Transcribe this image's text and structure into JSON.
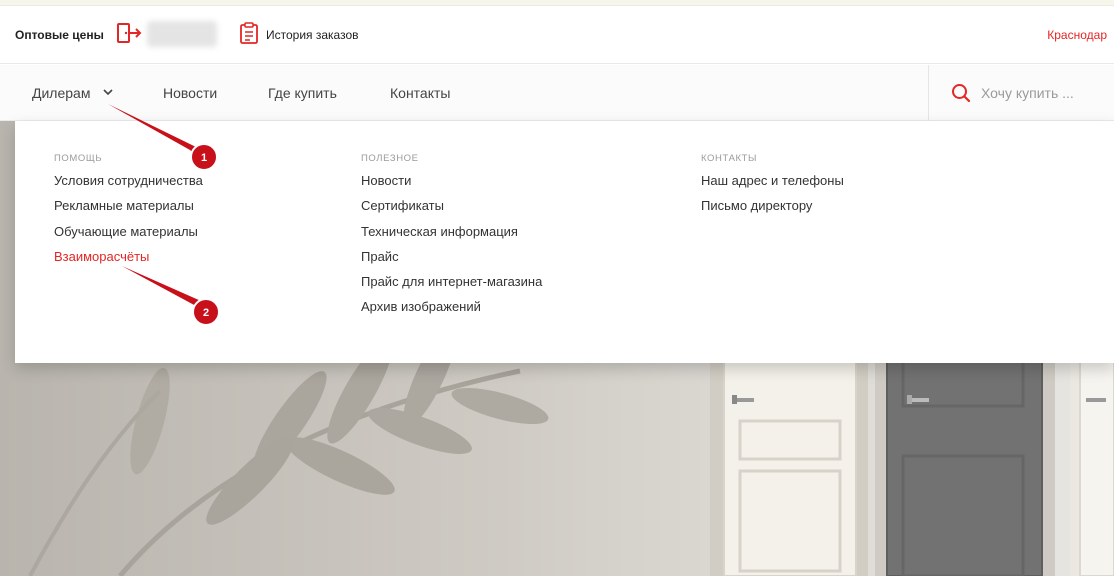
{
  "header": {
    "wholesale_label": "Оптовые цены",
    "history_label": "История заказов",
    "city": "Краснодар"
  },
  "nav": {
    "items": [
      "Дилерам",
      "Новости",
      "Где купить",
      "Контакты"
    ],
    "search_placeholder": "Хочу купить ..."
  },
  "dropdown": {
    "columns": [
      {
        "title": "ПОМОЩЬ",
        "links": [
          "Условия сотрудничества",
          "Рекламные материалы",
          "Обучающие материалы",
          "Взаиморасчёты"
        ]
      },
      {
        "title": "ПОЛЕЗНОЕ",
        "links": [
          "Новости",
          "Сертификаты",
          "Техническая информация",
          "Прайс",
          "Прайс для интернет-магазина",
          "Архив изображений"
        ]
      },
      {
        "title": "КОНТАКТЫ",
        "links": [
          "Наш адрес и телефоны",
          "Письмо директору"
        ]
      }
    ],
    "active_link": "Взаиморасчёты"
  },
  "annotations": {
    "marker_1": "1",
    "marker_2": "2"
  },
  "colors": {
    "accent": "#e32626",
    "annotation": "#c8101b"
  },
  "icons": {
    "logout": "logout-icon",
    "history": "clipboard-icon",
    "nav_dropdown": "chevron-down-icon",
    "search": "search-icon"
  }
}
